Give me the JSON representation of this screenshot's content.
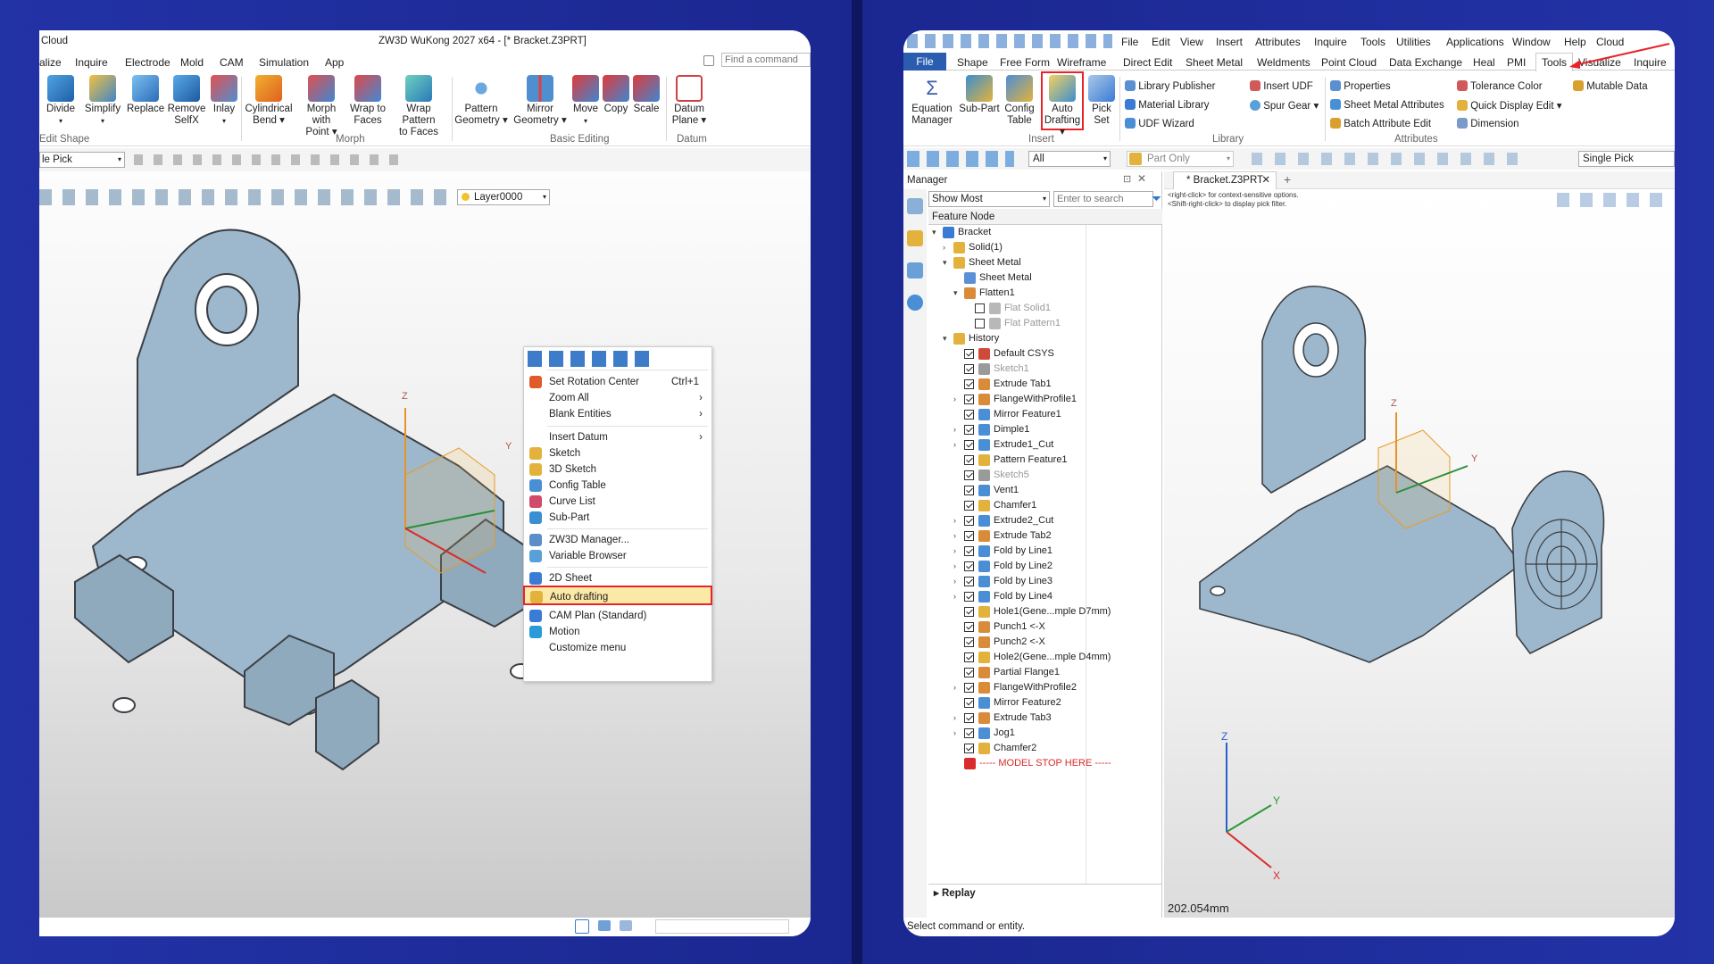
{
  "left": {
    "title": "ZW3D WuKong 2027 x64 - [* Bracket.Z3PRT]",
    "app_stub": "Cloud",
    "tabs": [
      "alize",
      "Inquire",
      "Electrode",
      "Mold",
      "CAM",
      "Simulation",
      "App"
    ],
    "find_placeholder": "Find a command",
    "ribbon_buttons": [
      {
        "label": "Divide",
        "sub": ""
      },
      {
        "label": "Simplify",
        "sub": ""
      },
      {
        "label": "Replace",
        "sub": ""
      },
      {
        "label": "Remove",
        "sub": "SelfX"
      },
      {
        "label": "Inlay",
        "sub": ""
      },
      {
        "label": "Cylindrical",
        "sub": "Bend"
      },
      {
        "label": "Morph with",
        "sub": "Point"
      },
      {
        "label": "Wrap to",
        "sub": "Faces"
      },
      {
        "label": "Wrap Pattern",
        "sub": "to Faces"
      },
      {
        "label": "Pattern",
        "sub": "Geometry"
      },
      {
        "label": "Mirror",
        "sub": "Geometry"
      },
      {
        "label": "Move",
        "sub": ""
      },
      {
        "label": "Copy",
        "sub": ""
      },
      {
        "label": "Scale",
        "sub": ""
      },
      {
        "label": "Datum",
        "sub": "Plane"
      }
    ],
    "groups": [
      "Edit Shape",
      "Morph",
      "Basic Editing",
      "Datum"
    ],
    "pick_filter": "le Pick",
    "layer": "Layer0000",
    "context_menu": [
      {
        "label": "Set Rotation Center",
        "shortcut": "Ctrl+1",
        "arrow": ""
      },
      {
        "label": "Zoom All",
        "shortcut": "",
        "arrow": "›"
      },
      {
        "label": "Blank Entities",
        "shortcut": "",
        "arrow": "›"
      },
      {
        "label": "Insert Datum",
        "shortcut": "",
        "arrow": "›"
      },
      {
        "label": "Sketch",
        "shortcut": "",
        "arrow": ""
      },
      {
        "label": "3D Sketch",
        "shortcut": "",
        "arrow": ""
      },
      {
        "label": "Config Table",
        "shortcut": "",
        "arrow": ""
      },
      {
        "label": "Curve List",
        "shortcut": "",
        "arrow": ""
      },
      {
        "label": "Sub-Part",
        "shortcut": "",
        "arrow": ""
      },
      {
        "label": "ZW3D Manager...",
        "shortcut": "",
        "arrow": ""
      },
      {
        "label": "Variable Browser",
        "shortcut": "",
        "arrow": ""
      },
      {
        "label": "2D Sheet",
        "shortcut": "",
        "arrow": ""
      },
      {
        "label": "Auto drafting",
        "shortcut": "",
        "arrow": ""
      },
      {
        "label": "CAM Plan (Standard)",
        "shortcut": "",
        "arrow": ""
      },
      {
        "label": "Motion",
        "shortcut": "",
        "arrow": ""
      },
      {
        "label": "Customize menu",
        "shortcut": "",
        "arrow": ""
      }
    ],
    "axis": {
      "z": "Z",
      "y": "Y"
    }
  },
  "right": {
    "menu": [
      "File",
      "Edit",
      "View",
      "Insert",
      "Attributes",
      "Inquire",
      "Tools",
      "Utilities",
      "Applications",
      "Window",
      "Help",
      "Cloud"
    ],
    "tabs": [
      "File",
      "Shape",
      "Free Form",
      "Wireframe",
      "Direct Edit",
      "Sheet Metal",
      "Weldments",
      "Point Cloud",
      "Data Exchange",
      "Heal",
      "PMI",
      "Tools",
      "Visualize",
      "Inquire"
    ],
    "big_buttons": [
      {
        "label": "Equation",
        "sub": "Manager"
      },
      {
        "label": "Sub-Part",
        "sub": ""
      },
      {
        "label": "Config",
        "sub": "Table"
      },
      {
        "label": "Auto",
        "sub": "Drafting"
      },
      {
        "label": "Pick",
        "sub": "Set"
      }
    ],
    "library_items": [
      "Library Publisher",
      "Material Library",
      "UDF Wizard",
      "Insert UDF",
      "Spur Gear"
    ],
    "attr_items": [
      "Properties",
      "Sheet Metal Attributes",
      "Batch Attribute Edit",
      "Tolerance Color",
      "Quick Display Edit",
      "Dimension",
      "Mutable Data"
    ],
    "groups": [
      "Insert",
      "Library",
      "Attributes"
    ],
    "filter_all": "All",
    "part_only": "Part Only",
    "single_pick": "Single Pick",
    "manager_title": "Manager",
    "show_most": "Show Most",
    "search_placeholder": "Enter to search",
    "tree_header": "Feature Node",
    "doc_tab": "* Bracket.Z3PRT",
    "hint1": "<right-click> for context-sensitive options.",
    "hint2": "<Shift-right-click> to display pick filter.",
    "tree": [
      {
        "label": "Bracket",
        "level": 0,
        "check": "none",
        "expand": "v",
        "color": "#3a7bd5"
      },
      {
        "label": "Solid(1)",
        "level": 1,
        "check": "none",
        "expand": ">",
        "color": "#e3b23c"
      },
      {
        "label": "Sheet Metal",
        "level": 1,
        "check": "none",
        "expand": "v",
        "color": "#e3b23c"
      },
      {
        "label": "Sheet Metal",
        "level": 2,
        "check": "none",
        "expand": "",
        "color": "#5b8fd6"
      },
      {
        "label": "Flatten1",
        "level": 2,
        "check": "none",
        "expand": "v",
        "color": "#d98b3a"
      },
      {
        "label": "Flat Solid1",
        "level": 3,
        "check": "off",
        "expand": "",
        "color": "#b8b8b8"
      },
      {
        "label": "Flat Pattern1",
        "level": 3,
        "check": "off",
        "expand": "",
        "color": "#b8b8b8"
      },
      {
        "label": "History",
        "level": 1,
        "check": "none",
        "expand": "v",
        "color": "#e3b23c"
      },
      {
        "label": "Default CSYS",
        "level": 2,
        "check": "on",
        "expand": "",
        "color": "#d04a3a"
      },
      {
        "label": "Sketch1",
        "level": 2,
        "check": "on",
        "expand": "",
        "color": "#9a9a9a"
      },
      {
        "label": "Extrude Tab1",
        "level": 2,
        "check": "on",
        "expand": "",
        "color": "#d98b3a"
      },
      {
        "label": "FlangeWithProfile1",
        "level": 2,
        "check": "on",
        "expand": ">",
        "color": "#d98b3a"
      },
      {
        "label": "Mirror Feature1",
        "level": 2,
        "check": "on",
        "expand": "",
        "color": "#4a8fd6"
      },
      {
        "label": "Dimple1",
        "level": 2,
        "check": "on",
        "expand": ">",
        "color": "#4a8fd6"
      },
      {
        "label": "Extrude1_Cut",
        "level": 2,
        "check": "on",
        "expand": ">",
        "color": "#4a8fd6"
      },
      {
        "label": "Pattern Feature1",
        "level": 2,
        "check": "on",
        "expand": "",
        "color": "#e3b23c"
      },
      {
        "label": "Sketch5",
        "level": 2,
        "check": "on",
        "expand": "",
        "color": "#9a9a9a"
      },
      {
        "label": "Vent1",
        "level": 2,
        "check": "on",
        "expand": "",
        "color": "#4a8fd6"
      },
      {
        "label": "Chamfer1",
        "level": 2,
        "check": "on",
        "expand": "",
        "color": "#e3b23c"
      },
      {
        "label": "Extrude2_Cut",
        "level": 2,
        "check": "on",
        "expand": ">",
        "color": "#4a8fd6"
      },
      {
        "label": "Extrude Tab2",
        "level": 2,
        "check": "on",
        "expand": ">",
        "color": "#d98b3a"
      },
      {
        "label": "Fold by Line1",
        "level": 2,
        "check": "on",
        "expand": ">",
        "color": "#4a8fd6"
      },
      {
        "label": "Fold by Line2",
        "level": 2,
        "check": "on",
        "expand": ">",
        "color": "#4a8fd6"
      },
      {
        "label": "Fold by Line3",
        "level": 2,
        "check": "on",
        "expand": ">",
        "color": "#4a8fd6"
      },
      {
        "label": "Fold by Line4",
        "level": 2,
        "check": "on",
        "expand": ">",
        "color": "#4a8fd6"
      },
      {
        "label": "Hole1(Gene...mple D7mm)",
        "level": 2,
        "check": "on",
        "expand": "",
        "color": "#e3b23c"
      },
      {
        "label": "Punch1 <-X",
        "level": 2,
        "check": "on",
        "expand": "",
        "color": "#d98b3a"
      },
      {
        "label": "Punch2 <-X",
        "level": 2,
        "check": "on",
        "expand": "",
        "color": "#d98b3a"
      },
      {
        "label": "Hole2(Gene...mple D4mm)",
        "level": 2,
        "check": "on",
        "expand": "",
        "color": "#e3b23c"
      },
      {
        "label": "Partial Flange1",
        "level": 2,
        "check": "on",
        "expand": "",
        "color": "#d98b3a"
      },
      {
        "label": "FlangeWithProfile2",
        "level": 2,
        "check": "on",
        "expand": ">",
        "color": "#d98b3a"
      },
      {
        "label": "Mirror Feature2",
        "level": 2,
        "check": "on",
        "expand": "",
        "color": "#4a8fd6"
      },
      {
        "label": "Extrude Tab3",
        "level": 2,
        "check": "on",
        "expand": ">",
        "color": "#d98b3a"
      },
      {
        "label": "Jog1",
        "level": 2,
        "check": "on",
        "expand": ">",
        "color": "#4a8fd6"
      },
      {
        "label": "Chamfer2",
        "level": 2,
        "check": "on",
        "expand": "",
        "color": "#e3b23c"
      },
      {
        "label": "----- MODEL STOP HERE -----",
        "level": 2,
        "check": "none",
        "expand": "",
        "color": "#d92b2b"
      }
    ],
    "replay": "Replay",
    "distance": "202.054mm",
    "status": "Select command or entity.",
    "axis": {
      "z": "Z",
      "y": "Y",
      "x": "X"
    }
  },
  "colors": {
    "highlight": "#e8242a",
    "part": "#9db8cc",
    "edge": "#3b3f45",
    "file_tab": "#2a5db0"
  }
}
